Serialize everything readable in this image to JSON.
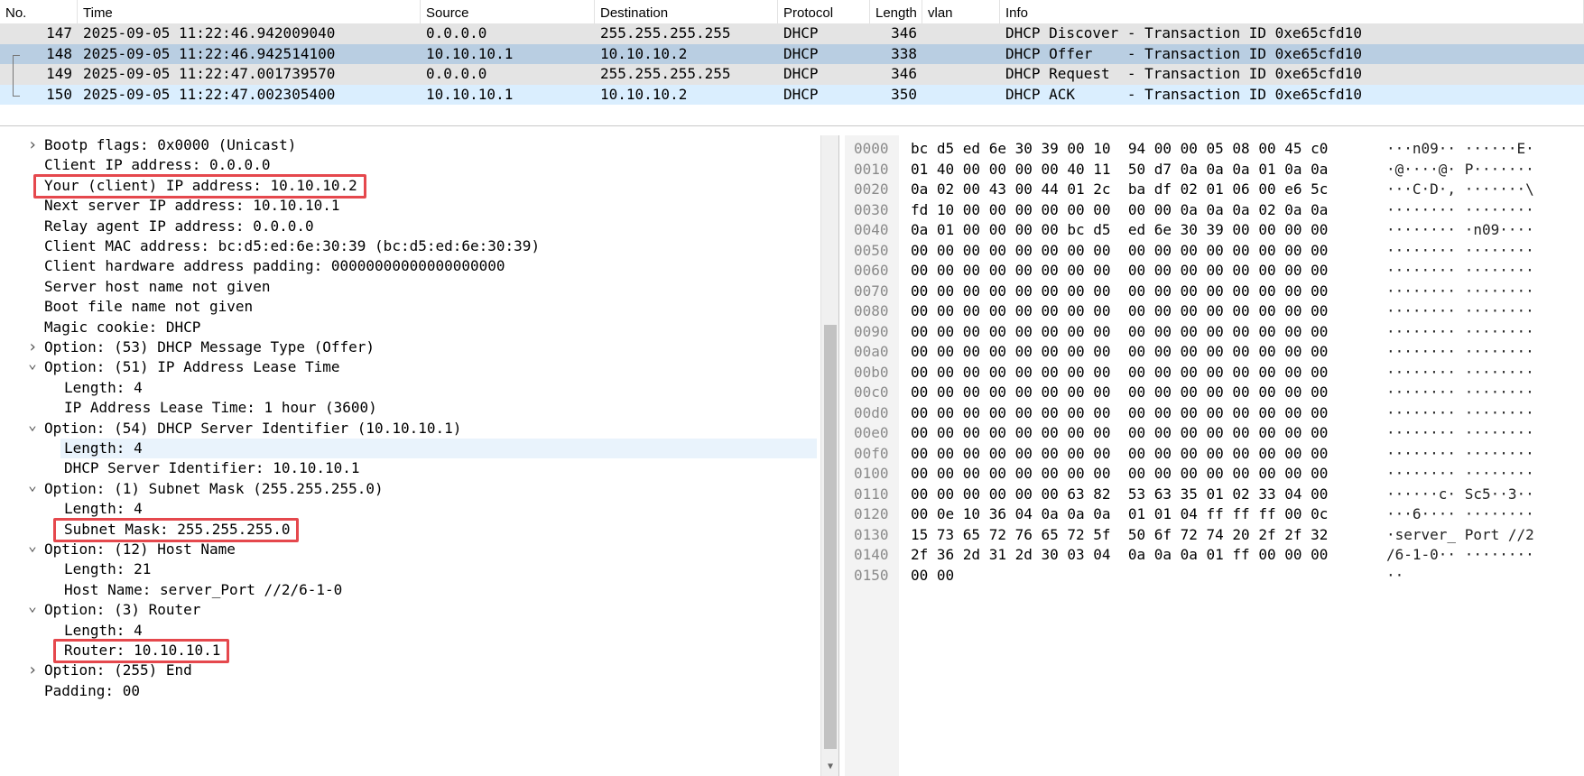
{
  "packet_list": {
    "columns": [
      "No.",
      "Time",
      "Source",
      "Destination",
      "Protocol",
      "Length",
      "vlan",
      "Info"
    ],
    "rows": [
      {
        "no": "147",
        "time": "2025-09-05 11:22:46.942009040",
        "source": "0.0.0.0",
        "destination": "255.255.255.255",
        "protocol": "DHCP",
        "length": "346",
        "vlan": "",
        "info": "DHCP Discover - Transaction ID 0xe65cfd10",
        "bg": "#e4e4e4"
      },
      {
        "no": "148",
        "time": "2025-09-05 11:22:46.942514100",
        "source": "10.10.10.1",
        "destination": "10.10.10.2",
        "protocol": "DHCP",
        "length": "338",
        "vlan": "",
        "info": "DHCP Offer    - Transaction ID 0xe65cfd10",
        "bg": "#b9cee2"
      },
      {
        "no": "149",
        "time": "2025-09-05 11:22:47.001739570",
        "source": "0.0.0.0",
        "destination": "255.255.255.255",
        "protocol": "DHCP",
        "length": "346",
        "vlan": "",
        "info": "DHCP Request  - Transaction ID 0xe65cfd10",
        "bg": "#e4e4e4"
      },
      {
        "no": "150",
        "time": "2025-09-05 11:22:47.002305400",
        "source": "10.10.10.1",
        "destination": "10.10.10.2",
        "protocol": "DHCP",
        "length": "350",
        "vlan": "",
        "info": "DHCP ACK      - Transaction ID 0xe65cfd10",
        "bg": "#daeefe"
      }
    ]
  },
  "details": {
    "rows": [
      {
        "text": "Bootp flags: 0x0000 (Unicast)",
        "level": 0,
        "arrow": "collapsed"
      },
      {
        "text": "Client IP address: 0.0.0.0",
        "level": 0,
        "arrow": "none"
      },
      {
        "text": "Your (client) IP address: 10.10.10.2",
        "level": 0,
        "arrow": "none",
        "highlighted": true
      },
      {
        "text": "Next server IP address: 10.10.10.1",
        "level": 0,
        "arrow": "none"
      },
      {
        "text": "Relay agent IP address: 0.0.0.0",
        "level": 0,
        "arrow": "none"
      },
      {
        "text": "Client MAC address: bc:d5:ed:6e:30:39 (bc:d5:ed:6e:30:39)",
        "level": 0,
        "arrow": "none"
      },
      {
        "text": "Client hardware address padding: 00000000000000000000",
        "level": 0,
        "arrow": "none"
      },
      {
        "text": "Server host name not given",
        "level": 0,
        "arrow": "none"
      },
      {
        "text": "Boot file name not given",
        "level": 0,
        "arrow": "none"
      },
      {
        "text": "Magic cookie: DHCP",
        "level": 0,
        "arrow": "none"
      },
      {
        "text": "Option: (53) DHCP Message Type (Offer)",
        "level": 0,
        "arrow": "collapsed"
      },
      {
        "text": "Option: (51) IP Address Lease Time",
        "level": 0,
        "arrow": "expanded"
      },
      {
        "text": "Length: 4",
        "level": 1,
        "arrow": "none"
      },
      {
        "text": "IP Address Lease Time: 1 hour (3600)",
        "level": 1,
        "arrow": "none"
      },
      {
        "text": "Option: (54) DHCP Server Identifier (10.10.10.1)",
        "level": 0,
        "arrow": "expanded"
      },
      {
        "text": "Length: 4",
        "level": 1,
        "arrow": "none",
        "selected": true
      },
      {
        "text": "DHCP Server Identifier: 10.10.10.1",
        "level": 1,
        "arrow": "none"
      },
      {
        "text": "Option: (1) Subnet Mask (255.255.255.0)",
        "level": 0,
        "arrow": "expanded"
      },
      {
        "text": "Length: 4",
        "level": 1,
        "arrow": "none"
      },
      {
        "text": "Subnet Mask: 255.255.255.0",
        "level": 1,
        "arrow": "none",
        "highlighted": true
      },
      {
        "text": "Option: (12) Host Name",
        "level": 0,
        "arrow": "expanded"
      },
      {
        "text": "Length: 21",
        "level": 1,
        "arrow": "none"
      },
      {
        "text": "Host Name: server_Port //2/6-1-0",
        "level": 1,
        "arrow": "none"
      },
      {
        "text": "Option: (3) Router",
        "level": 0,
        "arrow": "expanded"
      },
      {
        "text": "Length: 4",
        "level": 1,
        "arrow": "none"
      },
      {
        "text": "Router: 10.10.10.1",
        "level": 1,
        "arrow": "none",
        "highlighted": true
      },
      {
        "text": "Option: (255) End",
        "level": 0,
        "arrow": "collapsed"
      },
      {
        "text": "Padding: 00",
        "level": 0,
        "arrow": "none"
      }
    ]
  },
  "bytes": {
    "rows": [
      {
        "offset": "0000",
        "hex": "bc d5 ed 6e 30 39 00 10  94 00 00 05 08 00 45 c0",
        "ascii": "···n09·· ······E·"
      },
      {
        "offset": "0010",
        "hex": "01 40 00 00 00 00 40 11  50 d7 0a 0a 0a 01 0a 0a",
        "ascii": "·@····@· P·······"
      },
      {
        "offset": "0020",
        "hex": "0a 02 00 43 00 44 01 2c  ba df 02 01 06 00 e6 5c",
        "ascii": "···C·D·, ·······\\"
      },
      {
        "offset": "0030",
        "hex": "fd 10 00 00 00 00 00 00  00 00 0a 0a 0a 02 0a 0a",
        "ascii": "········ ········"
      },
      {
        "offset": "0040",
        "hex": "0a 01 00 00 00 00 bc d5  ed 6e 30 39 00 00 00 00",
        "ascii": "········ ·n09····"
      },
      {
        "offset": "0050",
        "hex": "00 00 00 00 00 00 00 00  00 00 00 00 00 00 00 00",
        "ascii": "········ ········"
      },
      {
        "offset": "0060",
        "hex": "00 00 00 00 00 00 00 00  00 00 00 00 00 00 00 00",
        "ascii": "········ ········"
      },
      {
        "offset": "0070",
        "hex": "00 00 00 00 00 00 00 00  00 00 00 00 00 00 00 00",
        "ascii": "········ ········"
      },
      {
        "offset": "0080",
        "hex": "00 00 00 00 00 00 00 00  00 00 00 00 00 00 00 00",
        "ascii": "········ ········"
      },
      {
        "offset": "0090",
        "hex": "00 00 00 00 00 00 00 00  00 00 00 00 00 00 00 00",
        "ascii": "········ ········"
      },
      {
        "offset": "00a0",
        "hex": "00 00 00 00 00 00 00 00  00 00 00 00 00 00 00 00",
        "ascii": "········ ········"
      },
      {
        "offset": "00b0",
        "hex": "00 00 00 00 00 00 00 00  00 00 00 00 00 00 00 00",
        "ascii": "········ ········"
      },
      {
        "offset": "00c0",
        "hex": "00 00 00 00 00 00 00 00  00 00 00 00 00 00 00 00",
        "ascii": "········ ········"
      },
      {
        "offset": "00d0",
        "hex": "00 00 00 00 00 00 00 00  00 00 00 00 00 00 00 00",
        "ascii": "········ ········"
      },
      {
        "offset": "00e0",
        "hex": "00 00 00 00 00 00 00 00  00 00 00 00 00 00 00 00",
        "ascii": "········ ········"
      },
      {
        "offset": "00f0",
        "hex": "00 00 00 00 00 00 00 00  00 00 00 00 00 00 00 00",
        "ascii": "········ ········"
      },
      {
        "offset": "0100",
        "hex": "00 00 00 00 00 00 00 00  00 00 00 00 00 00 00 00",
        "ascii": "········ ········"
      },
      {
        "offset": "0110",
        "hex": "00 00 00 00 00 00 63 82  53 63 35 01 02 33 04 00",
        "ascii": "······c· Sc5··3··"
      },
      {
        "offset": "0120",
        "hex": "00 0e 10 36 04 0a 0a 0a  01 01 04 ff ff ff 00 0c",
        "ascii": "···6···· ········"
      },
      {
        "offset": "0130",
        "hex": "15 73 65 72 76 65 72 5f  50 6f 72 74 20 2f 2f 32",
        "ascii": "·server_ Port //2"
      },
      {
        "offset": "0140",
        "hex": "2f 36 2d 31 2d 30 03 04  0a 0a 0a 01 ff 00 00 00",
        "ascii": "/6-1-0·· ········"
      },
      {
        "offset": "0150",
        "hex": "00 00",
        "ascii": "··"
      }
    ]
  },
  "colors": {
    "highlight_box": "#e5484d",
    "selected_detail_row": "#e9f3fc",
    "offset_column_bg": "#f3f3f3"
  },
  "icons": {
    "collapsed": "chevron-right-icon",
    "expanded": "chevron-down-icon",
    "scroll_down": "scroll-down-arrow-icon"
  }
}
